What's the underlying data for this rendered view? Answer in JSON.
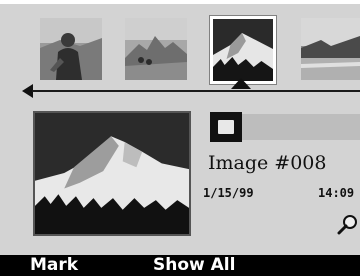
{
  "viewer": {
    "image_title": "Image #008",
    "date": "1/15/99",
    "time": "14:09"
  },
  "softkeys": {
    "left": "Mark",
    "middle": "Show All"
  },
  "filmstrip": {
    "thumbnails": [
      {
        "subject": "person-photo",
        "selected": false
      },
      {
        "subject": "landscape-photo",
        "selected": false
      },
      {
        "subject": "mountain-photo",
        "selected": true
      },
      {
        "subject": "coast-photo",
        "selected": false
      }
    ]
  },
  "icons": {
    "back": "left-arrow-icon",
    "selection": "pointer-icon",
    "zoom": "magnifier-icon"
  },
  "colors": {
    "background": "#d3d3d3",
    "softkey_bar": "#000000",
    "softkey_text": "#ffffff"
  }
}
